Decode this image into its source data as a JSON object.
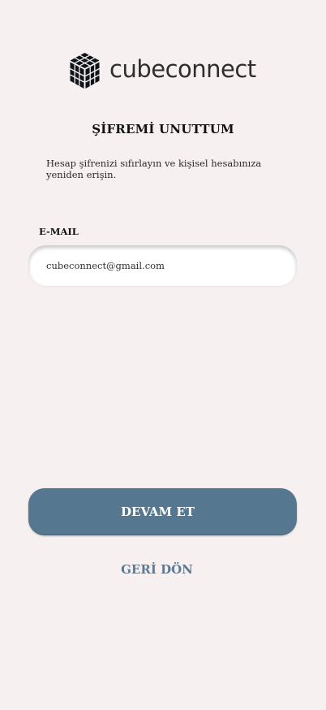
{
  "brand": {
    "name": "cubeconnect",
    "logo_icon": "cube-logo-icon"
  },
  "page": {
    "title": "ŞİFREMİ UNUTTUM",
    "subtitle": "Hesap şifrenizi sıfırlayın ve kişisel hesabınıza yeniden erişin."
  },
  "form": {
    "email_label": "E-MAIL",
    "email_value": "cubeconnect@gmail.com",
    "email_placeholder": ""
  },
  "actions": {
    "continue_label": "DEVAM ET",
    "back_label": "GERİ DÖN"
  },
  "colors": {
    "background": "#f6f0f0",
    "primary": "#55778f",
    "link": "#5c7a93"
  }
}
